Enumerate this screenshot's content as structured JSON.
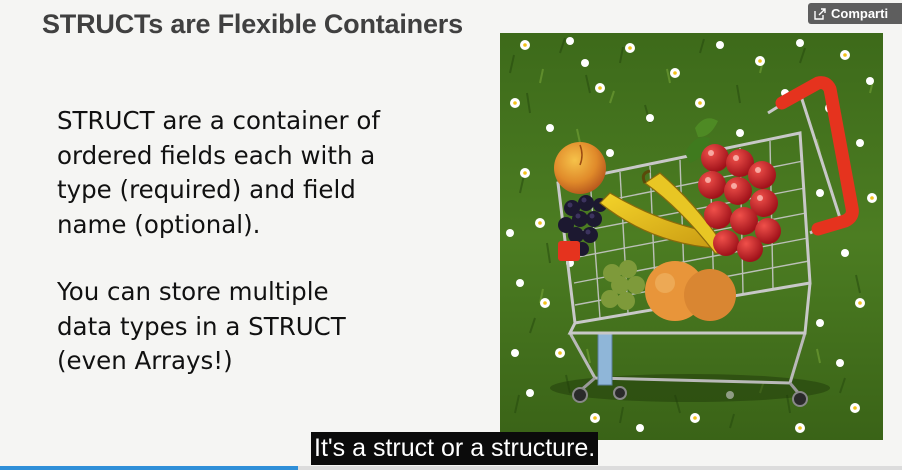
{
  "slide": {
    "title": "STRUCTs are Flexible Containers",
    "paragraphs": [
      {
        "lines": [
          "STRUCT are a container of",
          "ordered fields each with a",
          "type (required) and field",
          "name (optional)."
        ]
      },
      {
        "lines": [
          "You can store multiple",
          "data types in a STRUCT",
          "(even Arrays!)"
        ]
      }
    ]
  },
  "player": {
    "share_label": "Comparti",
    "share_icon": "external-share-icon",
    "caption": "It's a struct or a structure.",
    "progress_fraction": 0.33,
    "colors": {
      "caption_bg": "#0b0b0b",
      "progress": "#2f8fd8",
      "share_bg": "#5e5e5e"
    }
  }
}
